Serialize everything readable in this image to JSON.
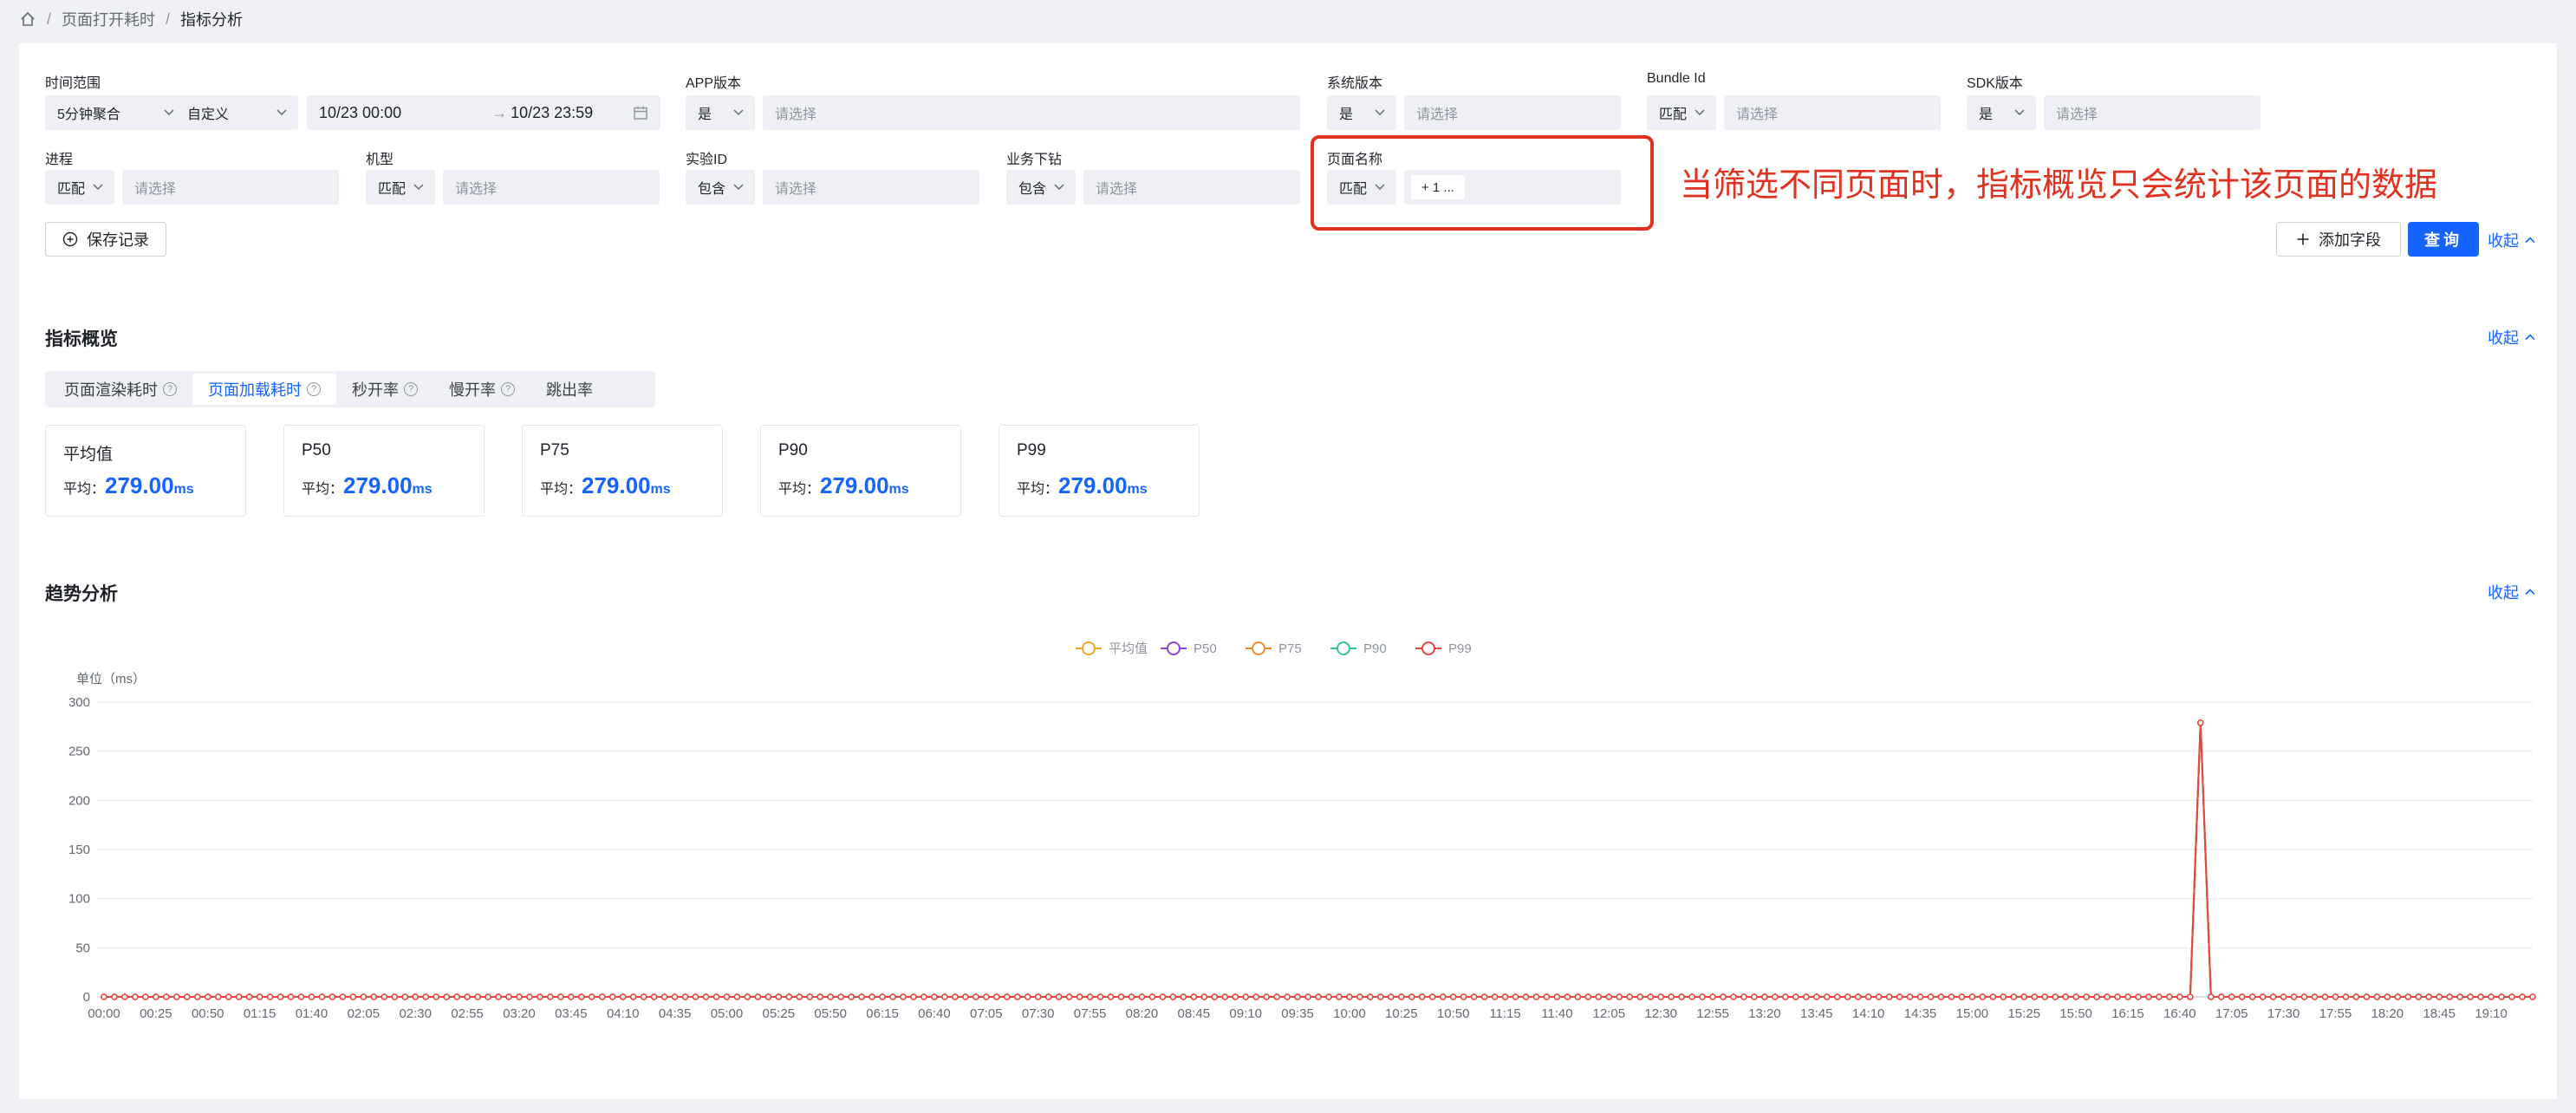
{
  "breadcrumb": {
    "items": [
      "页面打开耗时",
      "指标分析"
    ],
    "separator": "/"
  },
  "filters": {
    "time_range": {
      "label": "时间范围",
      "aggregate": "5分钟聚合",
      "mode": "自定义",
      "start": "10/23 00:00",
      "end": "10/23 23:59",
      "arrow": "→"
    },
    "app_version": {
      "label": "APP版本",
      "op": "是",
      "placeholder": "请选择"
    },
    "os_version": {
      "label": "系统版本",
      "op": "是",
      "placeholder": "请选择"
    },
    "bundle_id": {
      "label": "Bundle Id",
      "op": "匹配",
      "placeholder": "请选择"
    },
    "sdk_version": {
      "label": "SDK版本",
      "op": "是",
      "placeholder": "请选择"
    },
    "process": {
      "label": "进程",
      "op": "匹配",
      "placeholder": "请选择"
    },
    "device_model": {
      "label": "机型",
      "op": "匹配",
      "placeholder": "请选择"
    },
    "experiment_id": {
      "label": "实验ID",
      "op": "包含",
      "placeholder": "请选择"
    },
    "business_drill": {
      "label": "业务下钻",
      "op": "包含",
      "placeholder": "请选择"
    },
    "page_name": {
      "label": "页面名称",
      "op": "匹配",
      "tag": "+ 1 ..."
    }
  },
  "annotation": "当筛选不同页面时，指标概览只会统计该页面的数据",
  "actions": {
    "save_record": "保存记录",
    "add_field": "添加字段",
    "query": "查询",
    "collapse": "收起"
  },
  "overview": {
    "title": "指标概览",
    "collapse": "收起",
    "tabs": [
      "页面渲染耗时",
      "页面加载耗时",
      "秒开率",
      "慢开率",
      "跳出率"
    ],
    "active_tab": 1,
    "cards": [
      {
        "title": "平均值",
        "avg_label": "平均：",
        "value": "279.00",
        "unit": "ms"
      },
      {
        "title": "P50",
        "avg_label": "平均：",
        "value": "279.00",
        "unit": "ms"
      },
      {
        "title": "P75",
        "avg_label": "平均：",
        "value": "279.00",
        "unit": "ms"
      },
      {
        "title": "P90",
        "avg_label": "平均：",
        "value": "279.00",
        "unit": "ms"
      },
      {
        "title": "P99",
        "avg_label": "平均：",
        "value": "279.00",
        "unit": "ms"
      }
    ]
  },
  "trend": {
    "title": "趋势分析",
    "collapse": "收起"
  },
  "colors": {
    "accent": "#1664ff",
    "annotation": "#e0321f"
  },
  "chart_data": {
    "type": "line",
    "ylabel": "单位（ms）",
    "ylim": [
      0,
      300
    ],
    "y_ticks": [
      0,
      50,
      100,
      150,
      200,
      250,
      300
    ],
    "legend_position": "top-center",
    "grid": true,
    "interval_minutes": 5,
    "x_tick_labels": [
      "00:00",
      "00:25",
      "00:50",
      "01:15",
      "01:40",
      "02:05",
      "02:30",
      "02:55",
      "03:20",
      "03:45",
      "04:10",
      "04:35",
      "05:00",
      "05:25",
      "05:50",
      "06:15",
      "06:40",
      "07:05",
      "07:30",
      "07:55",
      "08:20",
      "08:45",
      "09:10",
      "09:35",
      "10:00",
      "10:25",
      "10:50",
      "11:15",
      "11:40",
      "12:05",
      "12:30",
      "12:55",
      "13:20",
      "13:45",
      "14:10",
      "14:35",
      "15:00",
      "15:25",
      "15:50",
      "16:15",
      "16:40",
      "17:05",
      "17:30",
      "17:55",
      "18:20",
      "18:45",
      "19:10"
    ],
    "x_range": [
      "00:00",
      "19:30"
    ],
    "series": [
      {
        "name": "平均值",
        "color": "#f5a623",
        "points": [
          [
            "16:50",
            279
          ]
        ],
        "baseline": 0
      },
      {
        "name": "P50",
        "color": "#8e44d9",
        "points": [
          [
            "16:50",
            279
          ]
        ],
        "baseline": 0
      },
      {
        "name": "P75",
        "color": "#f08c2e",
        "points": [
          [
            "16:50",
            279
          ]
        ],
        "baseline": 0
      },
      {
        "name": "P90",
        "color": "#36c48e",
        "points": [
          [
            "16:50",
            279
          ]
        ],
        "baseline": 0
      },
      {
        "name": "P99",
        "color": "#e8453c",
        "points": [
          [
            "16:50",
            279
          ]
        ],
        "baseline": 0
      }
    ]
  }
}
